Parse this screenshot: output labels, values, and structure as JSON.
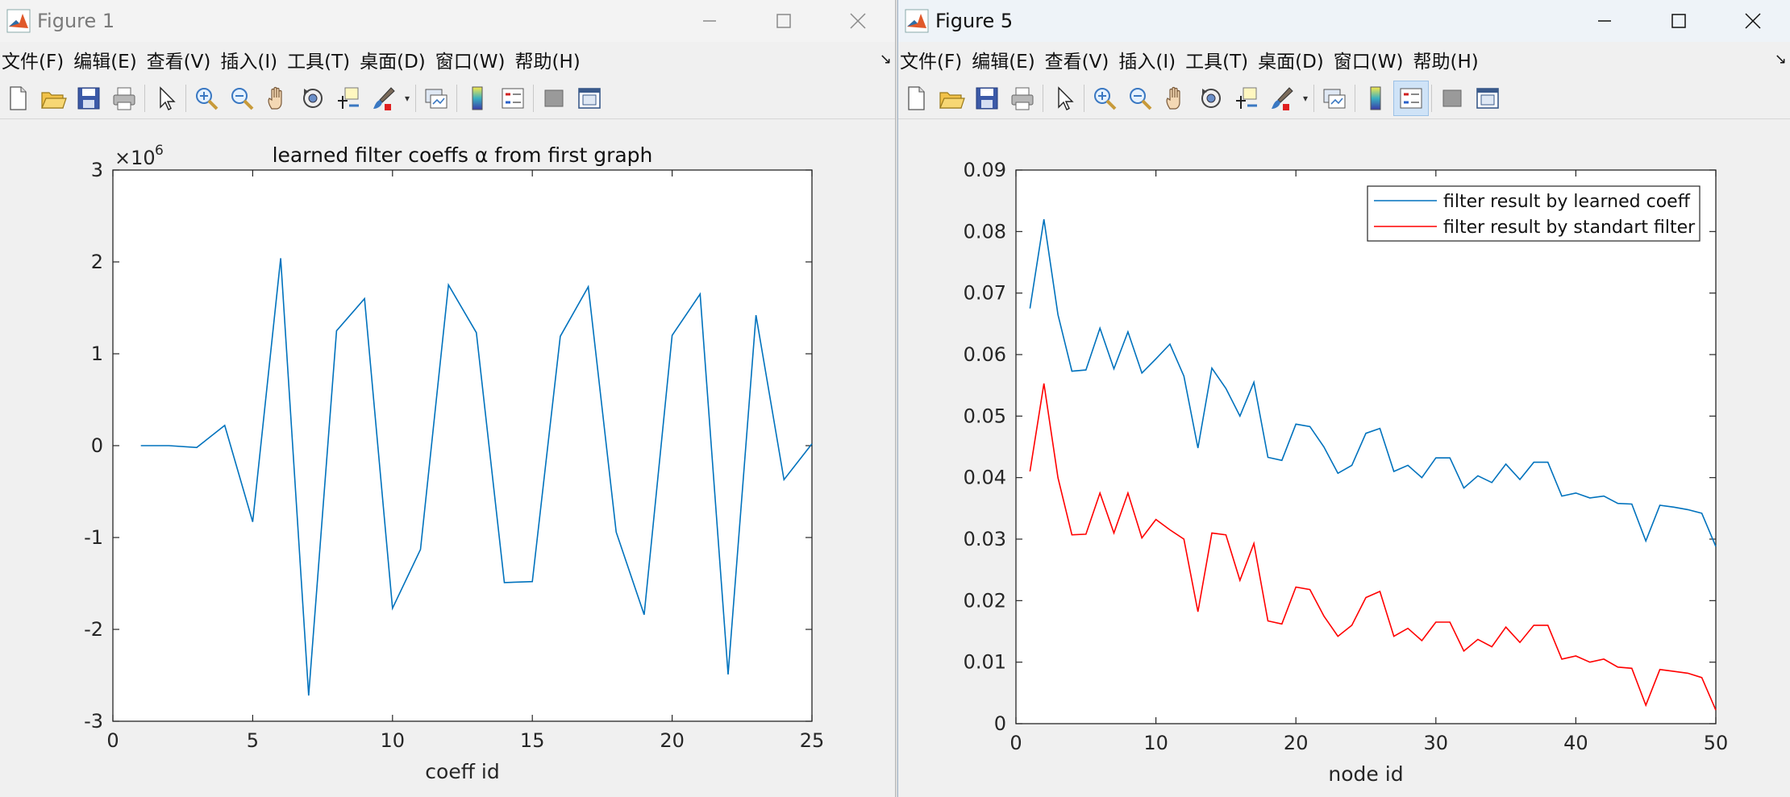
{
  "windows": [
    {
      "id": "figure-1",
      "title": "Figure 1",
      "active": false,
      "menu": [
        "文件(F)",
        "编辑(E)",
        "查看(V)",
        "插入(I)",
        "工具(T)",
        "桌面(D)",
        "窗口(W)",
        "帮助(H)"
      ],
      "toolbar_icons": [
        "new-figure-icon",
        "open-file-icon",
        "save-icon",
        "print-icon",
        "select-pointer-icon",
        "zoom-in-icon",
        "zoom-out-icon",
        "pan-hand-icon",
        "rotate-3d-icon",
        "data-cursor-icon",
        "brush-icon",
        "link-plot-icon",
        "colorbar-icon",
        "legend-icon",
        "hide-plot-tools-icon",
        "show-plot-tools-icon"
      ],
      "legend_button_pressed": false
    },
    {
      "id": "figure-5",
      "title": "Figure 5",
      "active": true,
      "menu": [
        "文件(F)",
        "编辑(E)",
        "查看(V)",
        "插入(I)",
        "工具(T)",
        "桌面(D)",
        "窗口(W)",
        "帮助(H)"
      ],
      "toolbar_icons": [
        "new-figure-icon",
        "open-file-icon",
        "save-icon",
        "print-icon",
        "select-pointer-icon",
        "zoom-in-icon",
        "zoom-out-icon",
        "pan-hand-icon",
        "rotate-3d-icon",
        "data-cursor-icon",
        "brush-icon",
        "link-plot-icon",
        "colorbar-icon",
        "legend-icon",
        "hide-plot-tools-icon",
        "show-plot-tools-icon"
      ],
      "legend_button_pressed": true
    }
  ],
  "colors": {
    "series_blue": "#0072BD",
    "series_red": "#FF0000",
    "matlab_orange": "#E0592A"
  },
  "chart_data": [
    {
      "type": "line",
      "title": "learned  filter coeffs  α from first graph",
      "xlabel": "coeff id",
      "ylabel": "",
      "exponent_label": "×10",
      "exponent_power": "6",
      "xlim": [
        0,
        25
      ],
      "ylim": [
        -3,
        3
      ],
      "xticks": [
        0,
        5,
        10,
        15,
        20,
        25
      ],
      "yticks": [
        -3,
        -2,
        -1,
        0,
        1,
        2,
        3
      ],
      "grid": false,
      "series": [
        {
          "color": "#0072BD",
          "x": [
            1,
            2,
            3,
            4,
            5,
            6,
            7,
            8,
            9,
            10,
            11,
            12,
            13,
            14,
            15,
            16,
            17,
            18,
            19,
            20,
            21,
            22,
            23,
            24,
            25
          ],
          "y": [
            0.0,
            0.0,
            -0.02,
            0.22,
            -0.83,
            2.04,
            -2.72,
            1.25,
            1.6,
            -1.77,
            -1.13,
            1.75,
            1.23,
            -1.49,
            -1.48,
            1.19,
            1.73,
            -0.94,
            -1.84,
            1.2,
            1.65,
            -2.49,
            1.42,
            -0.37,
            0.02
          ]
        }
      ]
    },
    {
      "type": "line",
      "title": "",
      "xlabel": "node id",
      "ylabel": "",
      "xlim": [
        0,
        50
      ],
      "ylim": [
        0,
        0.09
      ],
      "xticks": [
        0,
        10,
        20,
        30,
        40,
        50
      ],
      "yticks": [
        "0",
        "0.01",
        "0.02",
        "0.03",
        "0.04",
        "0.05",
        "0.06",
        "0.07",
        "0.08",
        "0.09"
      ],
      "grid": false,
      "legend_position": "top-right",
      "series": [
        {
          "name": "filter result by learned coeff",
          "color": "#0072BD",
          "x": [
            1,
            2,
            3,
            4,
            5,
            6,
            7,
            8,
            9,
            10,
            11,
            12,
            13,
            14,
            15,
            16,
            17,
            18,
            19,
            20,
            21,
            22,
            23,
            24,
            25,
            26,
            27,
            28,
            29,
            30,
            31,
            32,
            33,
            34,
            35,
            36,
            37,
            38,
            39,
            40,
            41,
            42,
            43,
            44,
            45,
            46,
            47,
            48,
            49,
            50
          ],
          "y": [
            0.0675,
            0.082,
            0.0665,
            0.0573,
            0.0575,
            0.0643,
            0.0577,
            0.0637,
            0.057,
            0.0593,
            0.0617,
            0.0565,
            0.0448,
            0.0578,
            0.0545,
            0.05,
            0.0555,
            0.0433,
            0.0428,
            0.0487,
            0.0483,
            0.045,
            0.0407,
            0.042,
            0.0472,
            0.048,
            0.041,
            0.042,
            0.04,
            0.0432,
            0.0432,
            0.0383,
            0.0403,
            0.0392,
            0.0422,
            0.0397,
            0.0425,
            0.0425,
            0.037,
            0.0375,
            0.0367,
            0.037,
            0.0358,
            0.0357,
            0.0297,
            0.0355,
            0.0352,
            0.0348,
            0.0342,
            0.0288
          ]
        },
        {
          "name": "filter result by standart filter",
          "color": "#FF0000",
          "x": [
            1,
            2,
            3,
            4,
            5,
            6,
            7,
            8,
            9,
            10,
            11,
            12,
            13,
            14,
            15,
            16,
            17,
            18,
            19,
            20,
            21,
            22,
            23,
            24,
            25,
            26,
            27,
            28,
            29,
            30,
            31,
            32,
            33,
            34,
            35,
            36,
            37,
            38,
            39,
            40,
            41,
            42,
            43,
            44,
            45,
            46,
            47,
            48,
            49,
            50
          ],
          "y": [
            0.041,
            0.0553,
            0.04,
            0.0307,
            0.0308,
            0.0375,
            0.031,
            0.0375,
            0.0302,
            0.0332,
            0.0315,
            0.03,
            0.0182,
            0.031,
            0.0307,
            0.0233,
            0.0293,
            0.0167,
            0.0162,
            0.0222,
            0.0218,
            0.0175,
            0.0142,
            0.016,
            0.0205,
            0.0215,
            0.0142,
            0.0155,
            0.0135,
            0.0165,
            0.0165,
            0.0118,
            0.0137,
            0.0125,
            0.0157,
            0.0132,
            0.016,
            0.016,
            0.0105,
            0.011,
            0.01,
            0.0105,
            0.0092,
            0.009,
            0.003,
            0.0088,
            0.0085,
            0.0082,
            0.0075,
            0.0022
          ]
        }
      ]
    }
  ]
}
